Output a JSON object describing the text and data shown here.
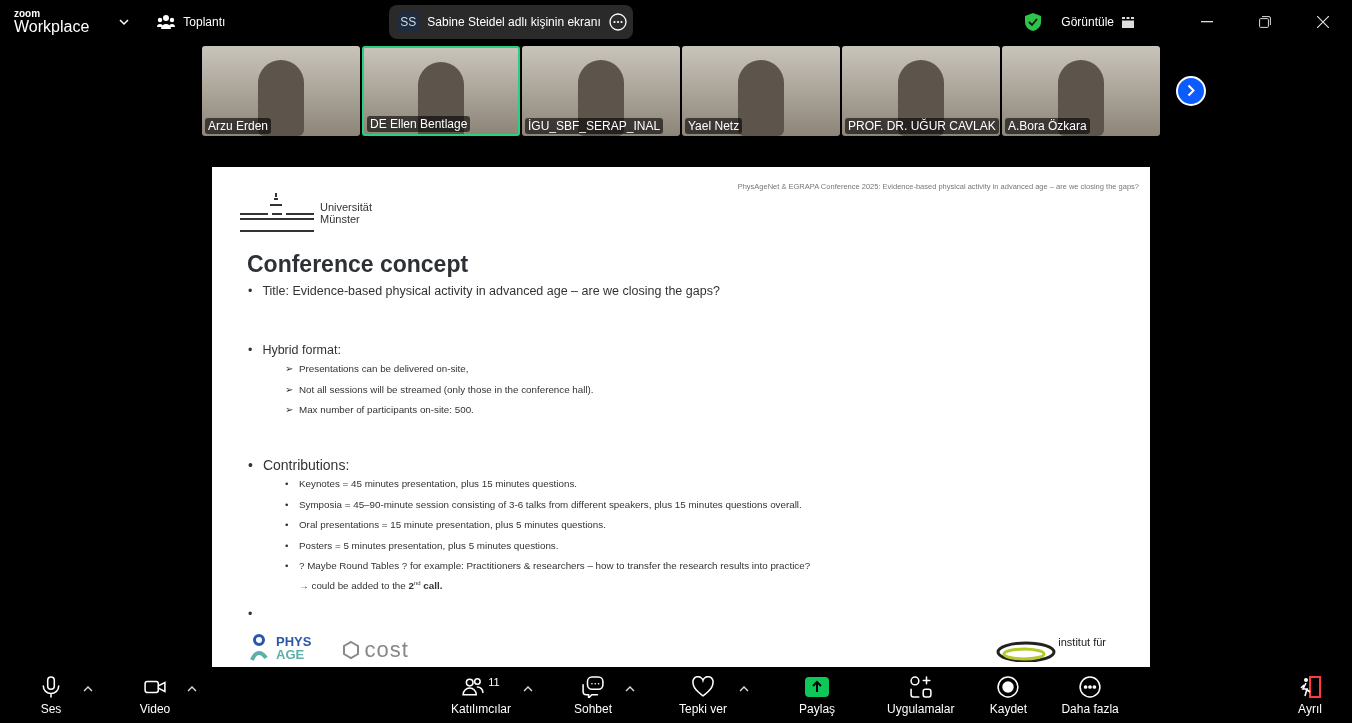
{
  "topbar": {
    "logo_top": "zoom",
    "logo_bottom": "Workplace",
    "meeting_label": "Toplantı",
    "share_initials": "SS",
    "share_label": "Sabine Steidel adlı kişinin ekranı",
    "view_label": "Görüntüle"
  },
  "participants": [
    {
      "name": "Arzu Erden",
      "selected": false
    },
    {
      "name": "DE Ellen Bentlage",
      "selected": true
    },
    {
      "name": "İGU_SBF_SERAP_INAL",
      "selected": false
    },
    {
      "name": "Yael Netz",
      "selected": false
    },
    {
      "name": "PROF. DR. UĞUR CAVLAK",
      "selected": false
    },
    {
      "name": "A.Bora Özkara",
      "selected": false
    }
  ],
  "slide": {
    "header": "PhysAgeNet & EGRAPA Conference 2025: Evidence-based physical activity in advanced age – are we closing the gaps?",
    "university": [
      "Universität",
      "Münster"
    ],
    "title": "Conference concept",
    "sections": [
      {
        "marker": "•",
        "text": "Title: Evidence-based physical activity in advanced age – are we closing the gaps?"
      },
      {
        "marker": "•",
        "text": "Hybrid format:",
        "items": [
          {
            "marker": "➢",
            "text": "Presentations can be delivered on-site,"
          },
          {
            "marker": "➢",
            "text": "Not all sessions will be streamed (only those in the conference hall)."
          },
          {
            "marker": "➢",
            "text": "Max number of participants on-site: 500."
          }
        ]
      },
      {
        "marker": "•",
        "text": "Contributions:",
        "items": [
          {
            "marker": "•",
            "text": "Keynotes = 45 minutes presentation, plus 15 minutes questions."
          },
          {
            "marker": "•",
            "text": "Symposia = 45–90-minute session consisting of 3-6 talks from different speakers, plus 15 minutes questions overall."
          },
          {
            "marker": "•",
            "text": "Oral presentations = 15 minute presentation, plus 5 minutes questions."
          },
          {
            "marker": "•",
            "text": "Posters = 5 minutes presentation, plus 5 minutes questions."
          },
          {
            "marker": "•",
            "text": "? Maybe Round Tables ? for example: Practitioners & researchers – how to transfer the research results into practice?",
            "note": "→ could be added to the **2**$^{nd}$ **call.**"
          }
        ]
      },
      {
        "marker": "•"
      }
    ],
    "logos": {
      "phys": [
        "PHYS",
        "AGE"
      ],
      "cost": "cost",
      "institute": "institut für"
    }
  },
  "toolbar": [
    {
      "kind": "mic",
      "label": "Ses",
      "menu": true
    },
    {
      "kind": "camera",
      "label": "Video",
      "menu": true
    },
    {
      "kind": "people",
      "label": "Katılımcılar",
      "count": "11",
      "menu": true
    },
    {
      "kind": "chat",
      "label": "Sohbet",
      "menu": true
    },
    {
      "kind": "heart",
      "label": "Tepki ver",
      "menu": true
    },
    {
      "kind": "share",
      "label": "Paylaş",
      "menu": false
    },
    {
      "kind": "apps",
      "label": "Uygulamalar",
      "menu": false
    },
    {
      "kind": "record",
      "label": "Kaydet",
      "menu": false
    },
    {
      "kind": "more",
      "label": "Daha fazla",
      "menu": false
    },
    {
      "kind": "leave",
      "label": "Ayrıl",
      "menu": false
    }
  ]
}
